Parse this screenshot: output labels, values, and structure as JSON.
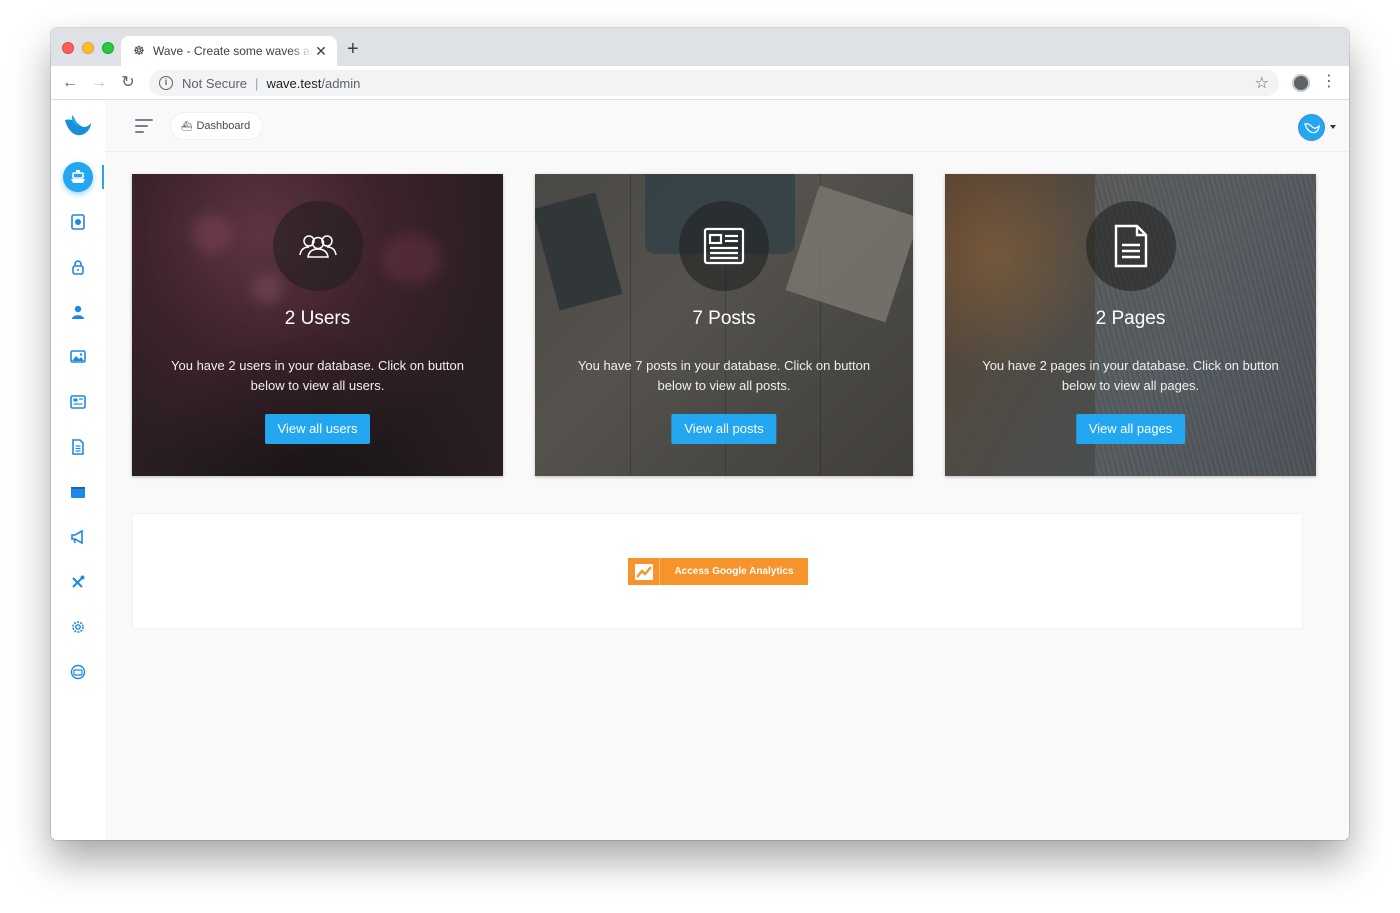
{
  "browser": {
    "tab_title": "Wave - Create some waves and build your SaaS",
    "new_tab_label": "+",
    "security_label": "Not Secure",
    "url_host": "wave.test",
    "url_path": "/admin"
  },
  "topbar": {
    "breadcrumb": "Dashboard"
  },
  "sidebar": {
    "items": [
      {
        "name": "dashboard",
        "icon": "boat-icon",
        "active": true
      },
      {
        "name": "media",
        "icon": "photo-icon"
      },
      {
        "name": "roles",
        "icon": "lock-icon"
      },
      {
        "name": "users",
        "icon": "person-icon"
      },
      {
        "name": "images",
        "icon": "images-icon"
      },
      {
        "name": "posts",
        "icon": "news-icon"
      },
      {
        "name": "pages",
        "icon": "file-icon"
      },
      {
        "name": "categories",
        "icon": "folder-icon"
      },
      {
        "name": "announcements",
        "icon": "megaphone-icon"
      },
      {
        "name": "tools",
        "icon": "tools-icon"
      },
      {
        "name": "settings",
        "icon": "gear-icon"
      },
      {
        "name": "hooks",
        "icon": "basket-icon"
      }
    ]
  },
  "cards": {
    "users": {
      "title": "2 Users",
      "description": "You have 2 users in your database. Click on button below to view all users.",
      "button": "View all users"
    },
    "posts": {
      "title": "7 Posts",
      "description": "You have 7 posts in your database. Click on button below to view all posts.",
      "button": "View all posts"
    },
    "pages": {
      "title": "2 Pages",
      "description": "You have 2 pages in your database. Click on button below to view all pages.",
      "button": "View all pages"
    }
  },
  "analytics": {
    "button": "Access Google Analytics"
  },
  "colors": {
    "accent": "#22a7f0",
    "analytics": "#f6932b"
  }
}
